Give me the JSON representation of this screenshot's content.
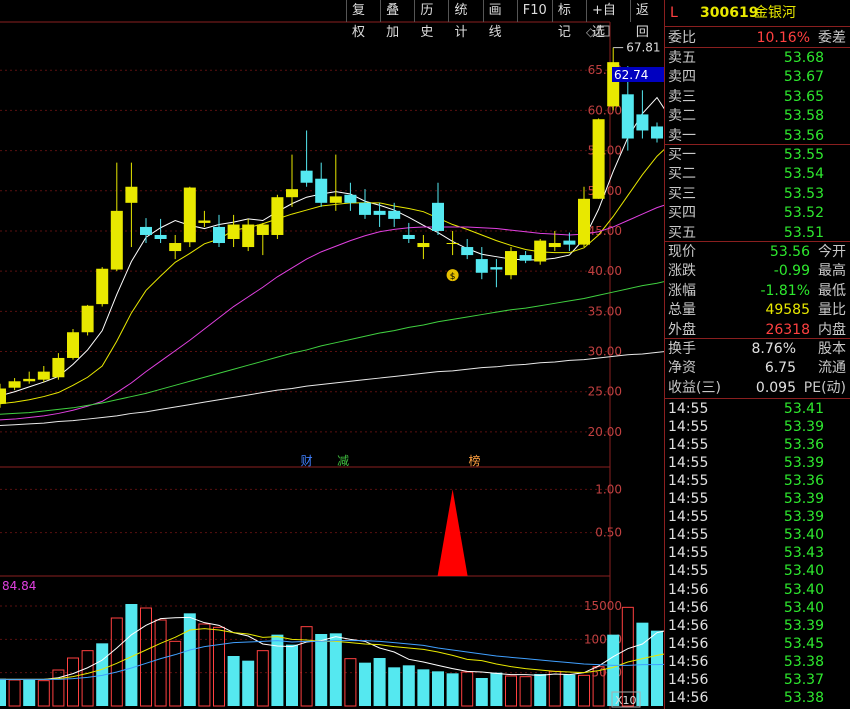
{
  "toolbar": {
    "items": [
      "复权",
      "叠加",
      "历史",
      "统计",
      "画线",
      "F10",
      "标记",
      "+自选",
      "返回"
    ]
  },
  "chart_labels": {
    "high_marker": "67.81",
    "current_price": "62.74",
    "event_markers": [
      "财",
      "减",
      "榜"
    ],
    "volume_max_label": "84.84",
    "volume_unit": "X10",
    "diamond_icon": "diamond-icon",
    "moneybag_icon": "moneybag-icon"
  },
  "chart_data": [
    {
      "type": "candlestick",
      "title": "",
      "ylim": [
        18,
        70
      ],
      "yticks": [
        "65.00",
        "60.00",
        "55.00",
        "50.00",
        "45.00",
        "40.00",
        "35.00",
        "30.00",
        "25.00",
        "20.00"
      ],
      "candles": [
        {
          "o": 23.5,
          "h": 26.0,
          "l": 23.0,
          "c": 25.4
        },
        {
          "o": 25.5,
          "h": 26.7,
          "l": 25.2,
          "c": 26.3
        },
        {
          "o": 26.3,
          "h": 27.5,
          "l": 26.0,
          "c": 26.6
        },
        {
          "o": 26.5,
          "h": 28.2,
          "l": 26.2,
          "c": 27.5
        },
        {
          "o": 26.8,
          "h": 29.8,
          "l": 26.5,
          "c": 29.2
        },
        {
          "o": 29.2,
          "h": 32.8,
          "l": 29.0,
          "c": 32.4
        },
        {
          "o": 32.4,
          "h": 35.8,
          "l": 32.0,
          "c": 35.7
        },
        {
          "o": 35.9,
          "h": 40.5,
          "l": 35.6,
          "c": 40.3
        },
        {
          "o": 40.2,
          "h": 53.5,
          "l": 40.0,
          "c": 47.5
        },
        {
          "o": 48.5,
          "h": 53.5,
          "l": 43.0,
          "c": 50.5
        },
        {
          "o": 45.5,
          "h": 46.6,
          "l": 43.5,
          "c": 44.5
        },
        {
          "o": 44.5,
          "h": 46.5,
          "l": 43.5,
          "c": 44.0
        },
        {
          "o": 42.5,
          "h": 44.5,
          "l": 41.5,
          "c": 43.5
        },
        {
          "o": 43.6,
          "h": 50.5,
          "l": 43.0,
          "c": 50.4
        },
        {
          "o": 46.0,
          "h": 47.5,
          "l": 45.5,
          "c": 46.3
        },
        {
          "o": 45.5,
          "h": 47.0,
          "l": 43.0,
          "c": 43.5
        },
        {
          "o": 44.0,
          "h": 47.0,
          "l": 43.0,
          "c": 45.8
        },
        {
          "o": 43.0,
          "h": 46.5,
          "l": 42.5,
          "c": 45.8
        },
        {
          "o": 44.5,
          "h": 46.0,
          "l": 42.0,
          "c": 45.8
        },
        {
          "o": 44.5,
          "h": 49.5,
          "l": 44.0,
          "c": 49.2
        },
        {
          "o": 49.2,
          "h": 54.5,
          "l": 48.0,
          "c": 50.2
        },
        {
          "o": 52.5,
          "h": 57.5,
          "l": 50.5,
          "c": 51.0
        },
        {
          "o": 51.5,
          "h": 53.5,
          "l": 48.0,
          "c": 48.5
        },
        {
          "o": 48.5,
          "h": 54.5,
          "l": 47.5,
          "c": 49.3
        },
        {
          "o": 49.5,
          "h": 51.0,
          "l": 47.5,
          "c": 48.5
        },
        {
          "o": 48.5,
          "h": 50.2,
          "l": 46.5,
          "c": 47.0
        },
        {
          "o": 47.5,
          "h": 48.5,
          "l": 45.5,
          "c": 47.0
        },
        {
          "o": 47.5,
          "h": 48.5,
          "l": 45.5,
          "c": 46.5
        },
        {
          "o": 44.5,
          "h": 46.0,
          "l": 43.5,
          "c": 44.0
        },
        {
          "o": 43.0,
          "h": 44.5,
          "l": 41.5,
          "c": 43.5
        },
        {
          "o": 48.5,
          "h": 51.0,
          "l": 44.5,
          "c": 45.0
        },
        {
          "o": 43.5,
          "h": 45.0,
          "l": 42.0,
          "c": 43.5
        },
        {
          "o": 43.0,
          "h": 44.0,
          "l": 41.5,
          "c": 42.0
        },
        {
          "o": 41.5,
          "h": 43.0,
          "l": 39.0,
          "c": 39.8
        },
        {
          "o": 40.5,
          "h": 41.5,
          "l": 38.0,
          "c": 40.2
        },
        {
          "o": 39.5,
          "h": 43.0,
          "l": 39.0,
          "c": 42.5
        },
        {
          "o": 42.0,
          "h": 42.5,
          "l": 41.0,
          "c": 41.3
        },
        {
          "o": 41.2,
          "h": 44.0,
          "l": 40.8,
          "c": 43.8
        },
        {
          "o": 43.0,
          "h": 45.0,
          "l": 42.5,
          "c": 43.5
        },
        {
          "o": 43.8,
          "h": 44.8,
          "l": 42.5,
          "c": 43.3
        },
        {
          "o": 43.3,
          "h": 50.5,
          "l": 43.0,
          "c": 49.0
        },
        {
          "o": 49.0,
          "h": 59.0,
          "l": 49.0,
          "c": 58.9
        },
        {
          "o": 60.5,
          "h": 67.81,
          "l": 60.0,
          "c": 66.0
        },
        {
          "o": 62.0,
          "h": 65.5,
          "l": 55.0,
          "c": 56.5
        },
        {
          "o": 59.5,
          "h": 62.5,
          "l": 56.5,
          "c": 57.5
        },
        {
          "o": 58.0,
          "h": 58.5,
          "l": 56.0,
          "c": 56.5
        },
        {
          "o": 57.5,
          "h": 58.5,
          "l": 55.5,
          "c": 56.0
        },
        {
          "o": 58.5,
          "h": 59.0,
          "l": 54.5,
          "c": 55.0
        },
        {
          "o": 56.0,
          "h": 57.0,
          "l": 52.5,
          "c": 53.56
        }
      ],
      "ma": [
        {
          "name": "MA5",
          "color": "#ffffff",
          "values": [
            24.5,
            25.0,
            25.6,
            26.2,
            26.9,
            28.4,
            30.2,
            32.6,
            37.1,
            41.2,
            44.2,
            45.4,
            46.3,
            45.7,
            45.3,
            45.8,
            46.1,
            46.5,
            46.3,
            47.4,
            48.4,
            49.2,
            49.6,
            49.9,
            49.6,
            48.7,
            48.2,
            47.6,
            46.7,
            45.7,
            44.8,
            43.7,
            42.8,
            42.1,
            41.8,
            41.5,
            41.4,
            41.4,
            41.6,
            42.0,
            44.0,
            47.7,
            52.4,
            56.6,
            59.6,
            61.6,
            58.8,
            56.9,
            55.5
          ]
        },
        {
          "name": "MA10",
          "color": "#e8e800",
          "values": [
            23.5,
            23.7,
            24.0,
            24.4,
            24.9,
            25.8,
            26.8,
            28.2,
            31.3,
            34.8,
            37.6,
            39.4,
            41.1,
            42.2,
            43.4,
            44.0,
            45.1,
            45.4,
            45.9,
            46.5,
            47.1,
            47.6,
            48.1,
            48.3,
            48.5,
            48.5,
            48.5,
            48.1,
            47.8,
            47.4,
            46.6,
            45.8,
            45.2,
            44.5,
            43.8,
            43.2,
            42.7,
            42.4,
            42.3,
            42.3,
            42.9,
            44.5,
            46.8,
            49.4,
            52.0,
            54.3,
            56.0,
            57.1,
            54.4
          ]
        },
        {
          "name": "MA20",
          "color": "#e040e0",
          "values": [
            21.5,
            21.6,
            21.8,
            22.0,
            22.3,
            22.7,
            23.2,
            23.8,
            24.9,
            26.1,
            27.5,
            28.8,
            30.1,
            31.4,
            32.8,
            34.2,
            35.6,
            36.8,
            38.0,
            39.3,
            40.4,
            41.5,
            42.4,
            43.1,
            43.8,
            44.4,
            44.9,
            45.2,
            45.4,
            45.5,
            45.5,
            45.5,
            45.5,
            45.4,
            45.3,
            45.1,
            44.9,
            44.7,
            44.6,
            44.5,
            44.6,
            44.9,
            45.5,
            46.3,
            47.1,
            47.9,
            48.5,
            48.8,
            49.0
          ]
        },
        {
          "name": "MA60",
          "color": "#40d040",
          "values": [
            22.2,
            22.3,
            22.4,
            22.6,
            22.8,
            23.0,
            23.3,
            23.6,
            24.0,
            24.4,
            24.8,
            25.3,
            25.8,
            26.3,
            26.8,
            27.3,
            27.8,
            28.3,
            28.8,
            29.3,
            29.8,
            30.2,
            30.7,
            31.1,
            31.5,
            31.9,
            32.3,
            32.6,
            33.0,
            33.3,
            33.7,
            34.0,
            34.3,
            34.6,
            34.9,
            35.2,
            35.4,
            35.7,
            36.0,
            36.3,
            36.6,
            37.0,
            37.4,
            37.8,
            38.2,
            38.5,
            38.9,
            39.2,
            38.5
          ]
        },
        {
          "name": "MA120",
          "color": "#e8e8e8",
          "values": [
            20.8,
            20.9,
            21.0,
            21.1,
            21.3,
            21.4,
            21.6,
            21.8,
            22.0,
            22.3,
            22.5,
            22.8,
            23.1,
            23.4,
            23.7,
            24.0,
            24.3,
            24.6,
            24.9,
            25.2,
            25.4,
            25.7,
            25.9,
            26.1,
            26.3,
            26.5,
            26.7,
            26.9,
            27.1,
            27.3,
            27.5,
            27.6,
            27.8,
            28.0,
            28.1,
            28.3,
            28.4,
            28.6,
            28.7,
            28.9,
            29.0,
            29.2,
            29.4,
            29.6,
            29.7,
            29.9,
            30.1,
            30.2,
            29.3
          ]
        }
      ]
    },
    {
      "type": "area",
      "title": "",
      "ylim": [
        0,
        1.2
      ],
      "yticks": [
        "1.00",
        "0.50"
      ],
      "spike": {
        "index": 31,
        "value": 1.0
      }
    },
    {
      "type": "bar",
      "title": "",
      "ylim": [
        0,
        18000
      ],
      "yticks": [
        "15000",
        "10000",
        "5000"
      ],
      "values": [
        4100,
        3900,
        4000,
        3800,
        5400,
        7200,
        8300,
        9400,
        13200,
        15300,
        14700,
        12900,
        9700,
        13900,
        12300,
        11800,
        7500,
        6800,
        8300,
        10700,
        9200,
        11900,
        10800,
        10900,
        7100,
        6500,
        7200,
        5800,
        6100,
        5500,
        5200,
        4900,
        5100,
        4200,
        5000,
        4500,
        4400,
        4800,
        5200,
        4700,
        4600,
        5900,
        10700,
        14800,
        12500,
        11300,
        10400,
        9100,
        6500
      ],
      "up": [
        false,
        true,
        false,
        true,
        true,
        true,
        true,
        false,
        true,
        false,
        true,
        true,
        true,
        false,
        true,
        true,
        false,
        false,
        true,
        false,
        false,
        true,
        false,
        false,
        true,
        false,
        false,
        false,
        false,
        false,
        false,
        false,
        true,
        false,
        false,
        true,
        true,
        false,
        true,
        false,
        true,
        true,
        false,
        true,
        false,
        false,
        false,
        false,
        false
      ],
      "ma": [
        {
          "name": "VMA5",
          "color": "#ffffff",
          "values": [
            4000,
            4000,
            4000,
            4000,
            4240,
            4860,
            5740,
            6880,
            8700,
            10680,
            12100,
            13100,
            13240,
            13300,
            12500,
            12100,
            11000,
            10500,
            9300,
            9000,
            8900,
            9600,
            9800,
            10400,
            10000,
            9700,
            8700,
            8100,
            7000,
            6600,
            6100,
            5600,
            5200,
            5100,
            4900,
            4700,
            4700,
            4600,
            4800,
            4700,
            5000,
            6000,
            7400,
            8600,
            9300,
            11000,
            11500,
            10800,
            9800
          ]
        },
        {
          "name": "VMA10",
          "color": "#e8e800",
          "values": [
            4000,
            4000,
            4000,
            4000,
            4100,
            4400,
            4900,
            5500,
            6400,
            7400,
            8400,
            9400,
            10300,
            11400,
            11600,
            11400,
            11000,
            10800,
            10300,
            10400,
            10000,
            9900,
            9700,
            9700,
            9500,
            9300,
            9200,
            8900,
            8700,
            8500,
            8100,
            7600,
            7000,
            6800,
            6300,
            5900,
            5600,
            5400,
            5200,
            5100,
            5000,
            5300,
            5800,
            6600,
            7100,
            7600,
            8000,
            8600,
            8400
          ]
        },
        {
          "name": "VMA20",
          "color": "#40a0ff",
          "values": [
            4000,
            4000,
            4000,
            4000,
            4000,
            4100,
            4300,
            4600,
            5100,
            5700,
            6400,
            7100,
            7700,
            8400,
            8900,
            9200,
            9500,
            9600,
            9700,
            9800,
            9600,
            9700,
            9700,
            9800,
            9800,
            9800,
            9700,
            9500,
            9300,
            9100,
            8700,
            8400,
            8100,
            7800,
            7500,
            7300,
            7100,
            6900,
            6700,
            6500,
            6300,
            6200,
            6100,
            6100,
            6200,
            6200,
            6300,
            6300,
            6500
          ]
        }
      ]
    }
  ],
  "panel": {
    "header": {
      "prefix": "L",
      "code": "300619",
      "name": "金银河"
    },
    "weibi": {
      "label": "委比",
      "value": "10.16%",
      "right": "委差"
    },
    "sell": [
      {
        "label": "卖五",
        "price": "53.68"
      },
      {
        "label": "卖四",
        "price": "53.67"
      },
      {
        "label": "卖三",
        "price": "53.65"
      },
      {
        "label": "卖二",
        "price": "53.58"
      },
      {
        "label": "卖一",
        "price": "53.56"
      }
    ],
    "buy": [
      {
        "label": "买一",
        "price": "53.55"
      },
      {
        "label": "买二",
        "price": "53.54"
      },
      {
        "label": "买三",
        "price": "53.53"
      },
      {
        "label": "买四",
        "price": "53.52"
      },
      {
        "label": "买五",
        "price": "53.51"
      }
    ],
    "quote": [
      {
        "label": "现价",
        "value": "53.56",
        "right": "今开",
        "color": "g"
      },
      {
        "label": "涨跌",
        "value": "-0.99",
        "right": "最高",
        "color": "g"
      },
      {
        "label": "涨幅",
        "value": "-1.81%",
        "right": "最低",
        "color": "g"
      },
      {
        "label": "总量",
        "value": "49585",
        "right": "量比",
        "color": "y"
      },
      {
        "label": "外盘",
        "value": "26318",
        "right": "内盘",
        "color": "r"
      }
    ],
    "stats": [
      {
        "label": "换手",
        "value": "8.76%",
        "right": "股本"
      },
      {
        "label": "净资",
        "value": "6.75",
        "right": "流通"
      },
      {
        "label": "收益(三)",
        "value": "0.095",
        "right": "PE(动)"
      }
    ],
    "ticks": [
      {
        "time": "14:55",
        "price": "53.41"
      },
      {
        "time": "14:55",
        "price": "53.39"
      },
      {
        "time": "14:55",
        "price": "53.36"
      },
      {
        "time": "14:55",
        "price": "53.39"
      },
      {
        "time": "14:55",
        "price": "53.36"
      },
      {
        "time": "14:55",
        "price": "53.39"
      },
      {
        "time": "14:55",
        "price": "53.39"
      },
      {
        "time": "14:55",
        "price": "53.40"
      },
      {
        "time": "14:55",
        "price": "53.43"
      },
      {
        "time": "14:55",
        "price": "53.40"
      },
      {
        "time": "14:56",
        "price": "53.40"
      },
      {
        "time": "14:56",
        "price": "53.40"
      },
      {
        "time": "14:56",
        "price": "53.39"
      },
      {
        "time": "14:56",
        "price": "53.45"
      },
      {
        "time": "14:56",
        "price": "53.38"
      },
      {
        "time": "14:56",
        "price": "53.37"
      },
      {
        "time": "14:56",
        "price": "53.38"
      }
    ]
  }
}
